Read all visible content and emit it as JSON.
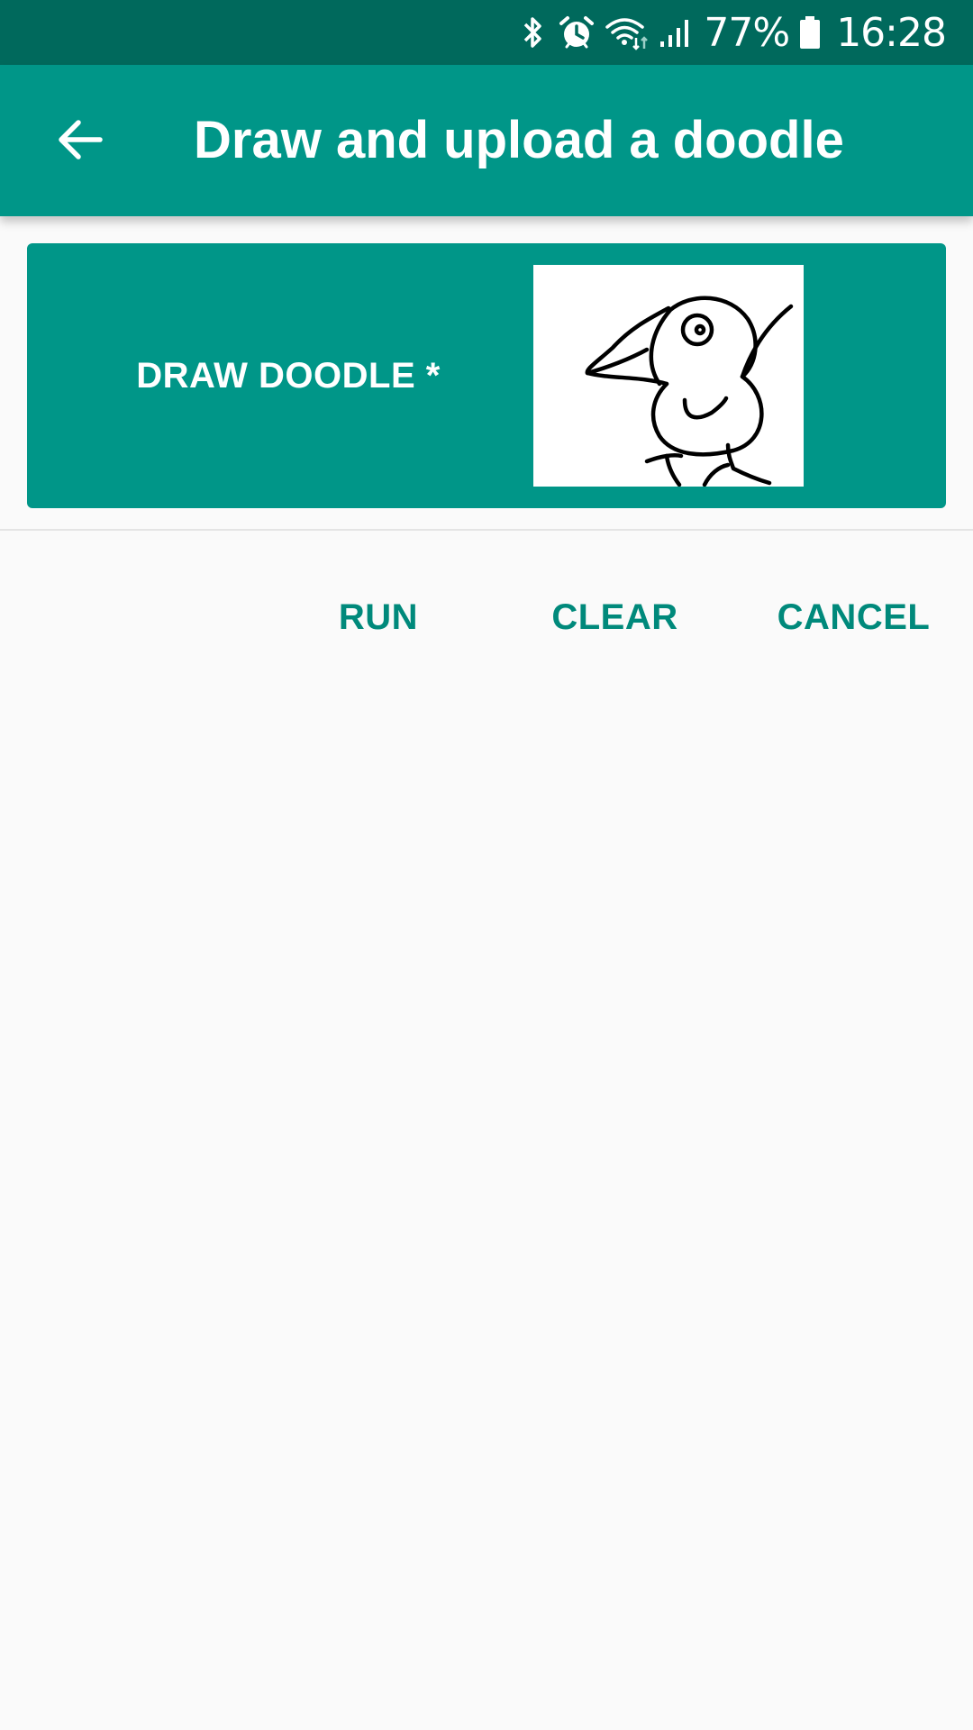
{
  "status_bar": {
    "battery_percent": "77%",
    "time": "16:28",
    "icons": [
      "bluetooth-icon",
      "alarm-icon",
      "wifi-icon",
      "signal-icon",
      "battery-icon"
    ]
  },
  "app_bar": {
    "title": "Draw and upload a doodle",
    "back_icon": "arrow-left-icon"
  },
  "doodle_field": {
    "label": "DRAW DOODLE *",
    "preview": "doodle-image"
  },
  "actions": {
    "run_label": "RUN",
    "clear_label": "CLEAR",
    "cancel_label": "CANCEL"
  },
  "colors": {
    "status_bar": "#00695c",
    "primary": "#009688",
    "button_text": "#00897b",
    "background": "#fafafa"
  }
}
